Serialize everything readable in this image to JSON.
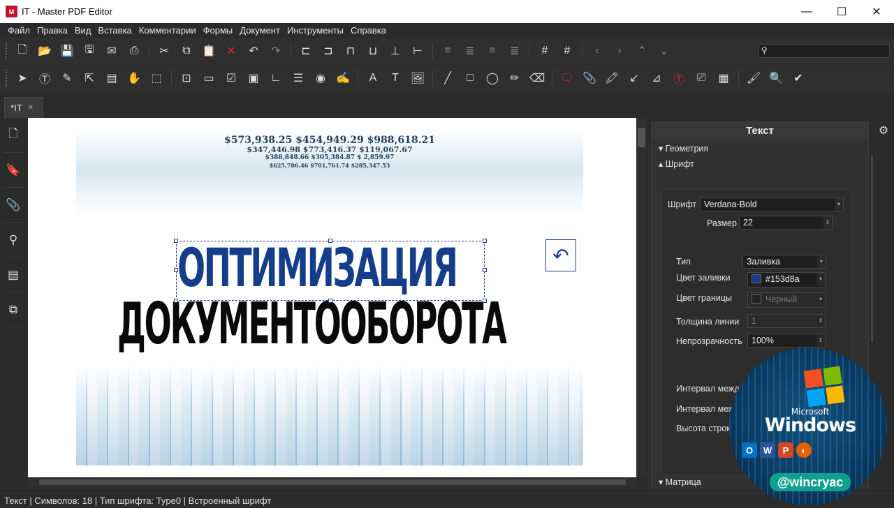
{
  "window": {
    "title": "IT - Master PDF Editor",
    "logo_text": "M",
    "minimize": "—",
    "maximize": "☐",
    "close": "✕"
  },
  "menu": [
    "Файл",
    "Правка",
    "Вид",
    "Вставка",
    "Комментарии",
    "Формы",
    "Документ",
    "Инструменты",
    "Справка"
  ],
  "toolbar": {
    "search_placeholder": ""
  },
  "tab": {
    "label": "*IT",
    "close": "✕"
  },
  "document": {
    "headline1": "ОПТИМИЗАЦИЯ",
    "headline2": "ДОКУМЕНТООБОРОТА",
    "numbers_line1": "$573,938.25   $454,949.29   $988,618.21",
    "numbers_line2": "$347,446.98   $773,416.37   $119,067.67",
    "numbers_line3": "$388,848.66   $305,384.87   $ 2,859.97",
    "numbers_line4": "$625,786.46   $701,761.74   $285,347.53",
    "headline1_color": "#153d8a"
  },
  "panel": {
    "title": "Текст",
    "section_geometry": "Геометрия",
    "section_font": "Шрифт",
    "section_matrix": "Матрица",
    "font_label": "Шрифт",
    "font_value": "Verdana-Bold",
    "size_label": "Размер",
    "size_value": "22",
    "type_label": "Тип",
    "type_value": "Заливка",
    "fill_color_label": "Цвет заливки",
    "fill_color_value": "#153d8a",
    "border_color_label": "Цвет границы",
    "border_color_value": "Черный",
    "line_width_label": "Толщина линии",
    "line_width_value": "1",
    "opacity_label": "Непрозрачность",
    "opacity_value": "100%",
    "interval1_label": "Интервал между",
    "interval2_label": "Интервал меж",
    "line_height_label": "Высота строк"
  },
  "status": "Текст | Символов: 18 | Тип шрифта: Type0 | Встроенный шрифт",
  "watermark": {
    "microsoft": "Microsoft",
    "windows": "Windows",
    "handle": "@wincryac"
  }
}
